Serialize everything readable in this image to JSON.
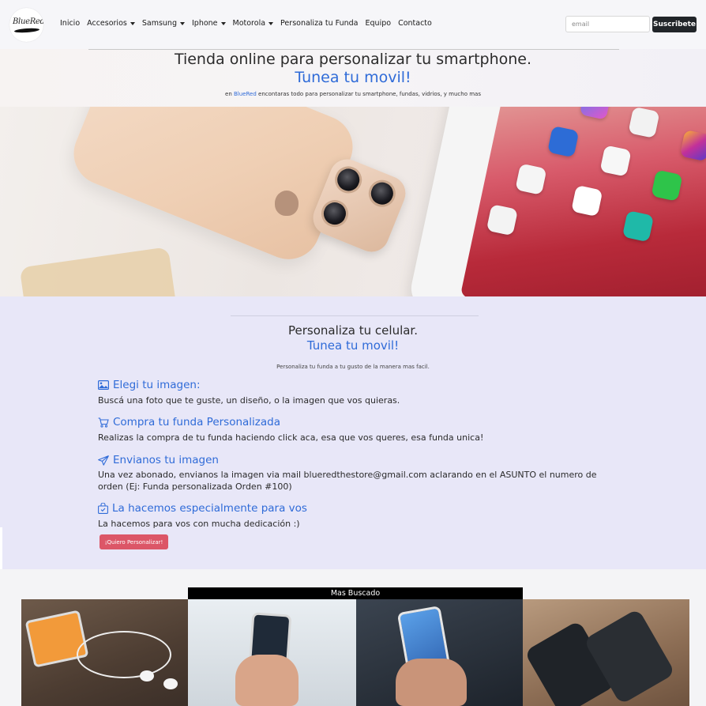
{
  "logo": {
    "text": "BlueRed"
  },
  "nav": {
    "items": [
      {
        "label": "Inicio",
        "dropdown": false
      },
      {
        "label": "Accesorios",
        "dropdown": true
      },
      {
        "label": "Samsung",
        "dropdown": true
      },
      {
        "label": "Iphone",
        "dropdown": true
      },
      {
        "label": "Motorola",
        "dropdown": true
      },
      {
        "label": "Personaliza tu Funda",
        "dropdown": false
      },
      {
        "label": "Equipo",
        "dropdown": false
      },
      {
        "label": "Contacto",
        "dropdown": false
      }
    ],
    "email_placeholder": "email",
    "subscribe_label": "Suscribete"
  },
  "hero": {
    "title": "Tienda online para personalizar tu smartphone.",
    "subtitle": "Tunea tu movil!",
    "small_prefix": "en",
    "small_brand": "BlueRed",
    "small_rest": "encontaras todo para personalizar tu smartphone, fundas, vidrios, y mucho mas"
  },
  "banner": {
    "next_icon": "chevron-right-icon"
  },
  "personaliza": {
    "title": "Personaliza tu celular.",
    "subtitle": "Tunea tu movil!",
    "small": "Personaliza tu funda a tu gusto de la manera mas facil.",
    "steps": [
      {
        "icon": "image-icon",
        "title": "Elegi tu imagen:",
        "text": "Buscá una foto que te guste, un diseño, o la imagen que vos quieras."
      },
      {
        "icon": "cart-icon",
        "title": "Compra tu funda Personalizada",
        "text": "Realizas la compra de tu funda haciendo click aca, esa que vos queres, esa funda unica!"
      },
      {
        "icon": "send-icon",
        "title": "Envianos tu imagen",
        "text": "Una vez abonado, envianos la imagen via mail blueredthestore@gmail.com aclarando en el ASUNTO el numero de orden (Ej: Funda personalizada Orden #100)"
      },
      {
        "icon": "bag-check-icon",
        "title": "La hacemos especialmente para vos",
        "text": "La hacemos para vos con mucha dedicación :)"
      }
    ],
    "cta_label": "¡Quiero Personalizar!"
  },
  "mas_buscado": {
    "title": "Mas Buscado"
  },
  "colors": {
    "accent_blue": "#2f6bd8",
    "cta_red": "#dc5667",
    "section_lilac": "#e8e7f8"
  }
}
